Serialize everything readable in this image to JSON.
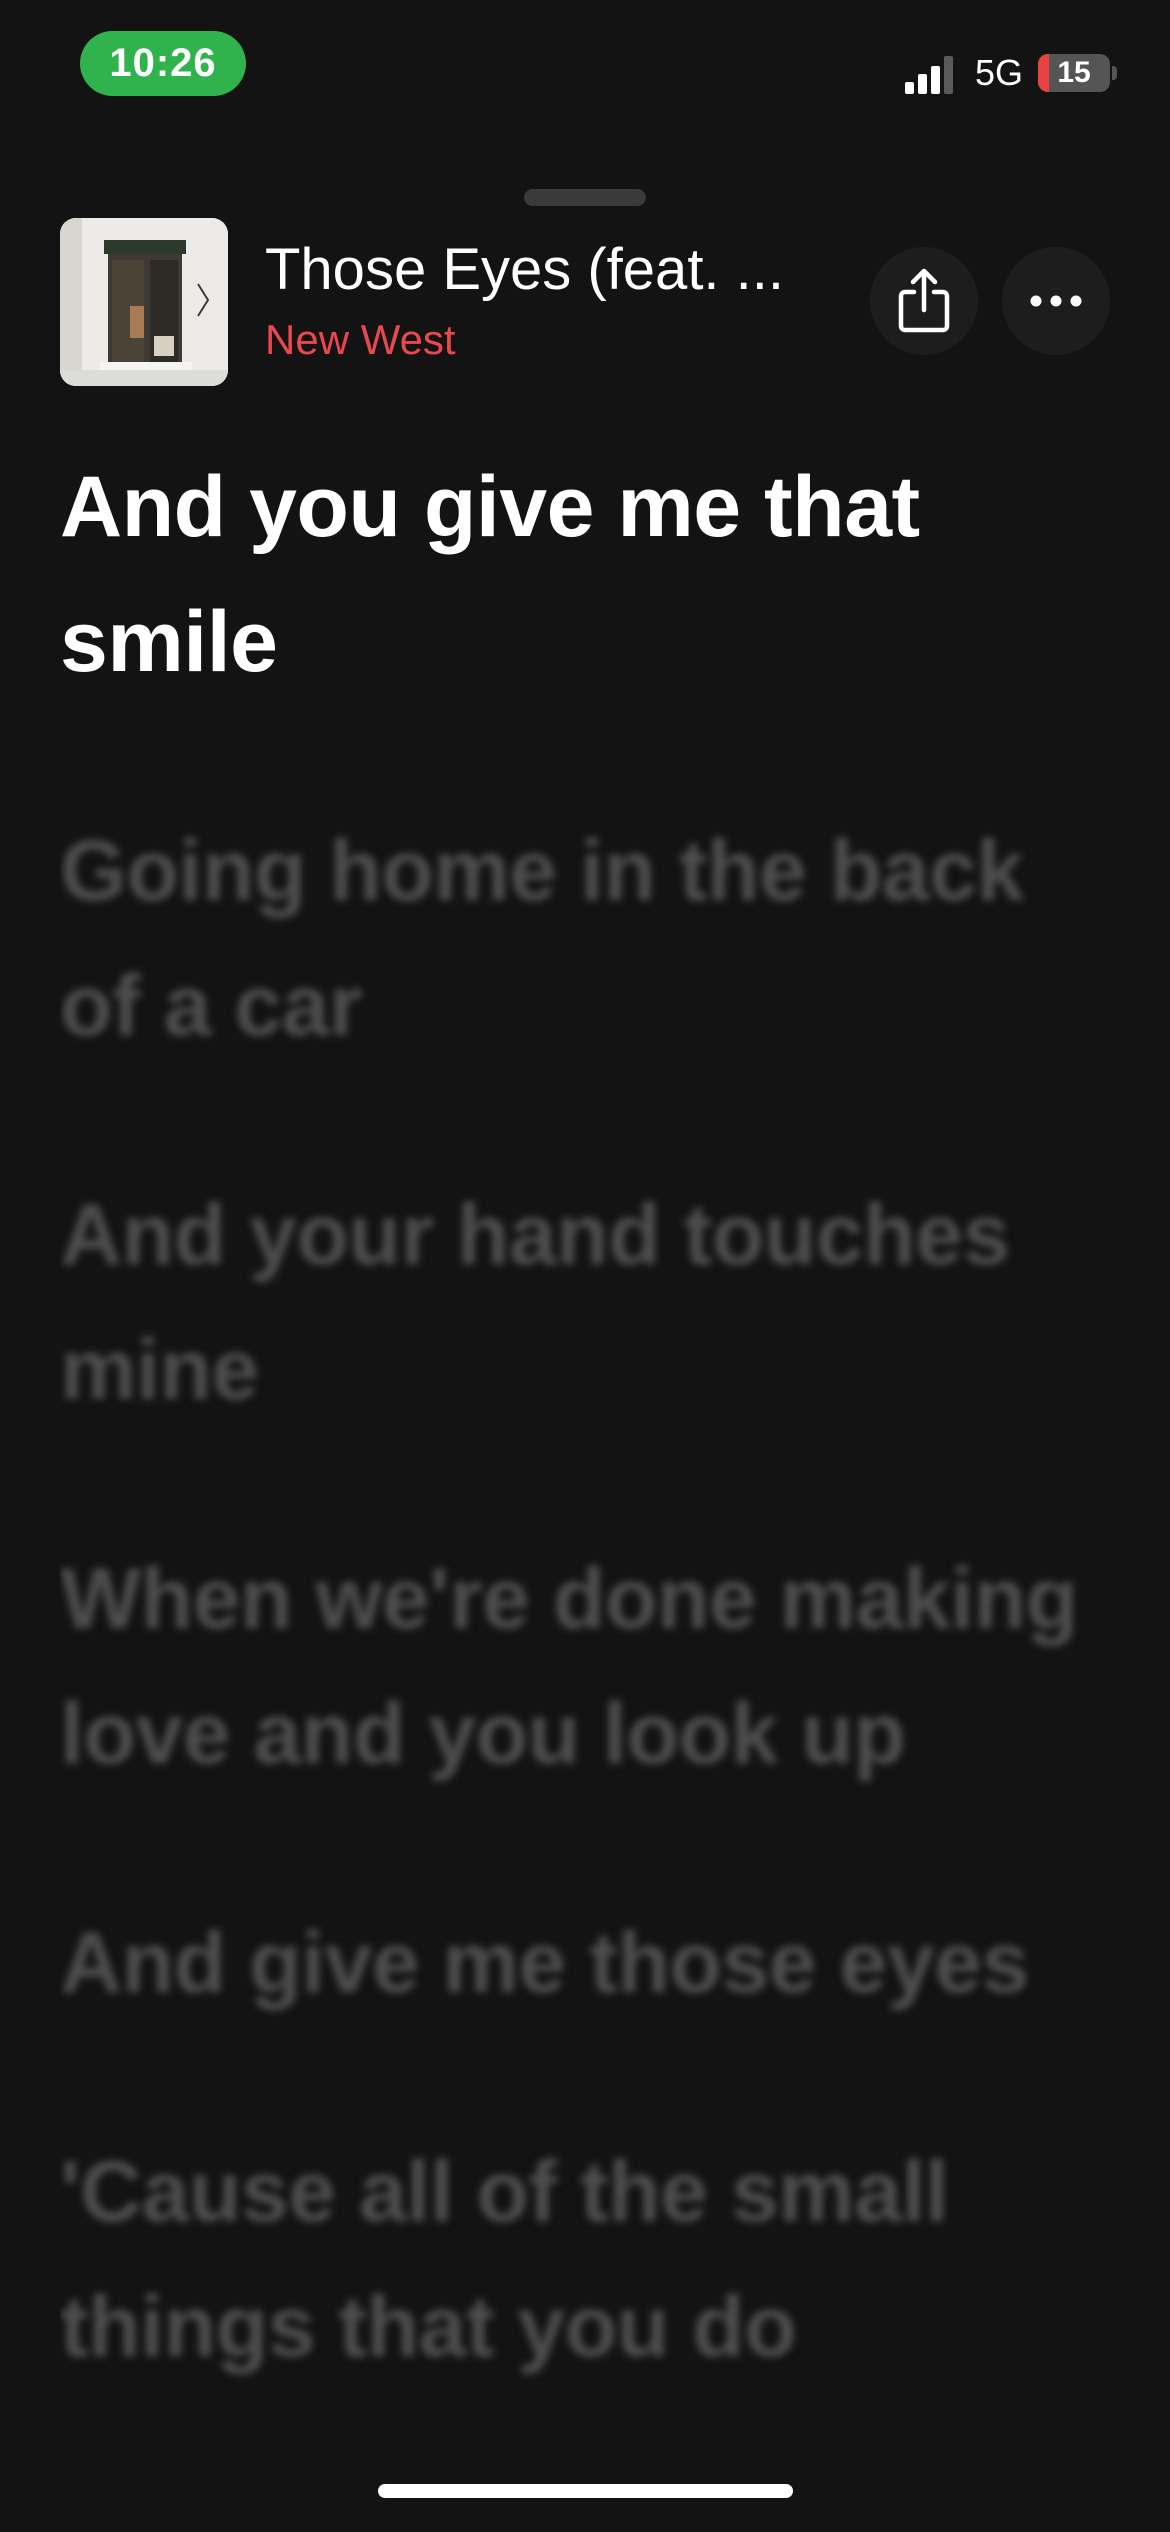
{
  "status_bar": {
    "time": "10:26",
    "network": "5G",
    "battery_level": "15",
    "battery_fraction": 0.15,
    "time_pill_color": "#30b34c",
    "battery_low_color": "#eb4141"
  },
  "now_playing": {
    "title": "Those Eyes (feat. ...",
    "artist": "New West",
    "artist_color": "#e8484e",
    "artwork_icon": "album-artwork-image",
    "share_icon": "share-icon",
    "more_icon": "ellipsis-icon"
  },
  "lyrics": {
    "current": "And you give me that smile",
    "upcoming": [
      "Going home in the back of a car",
      "And your hand touches mine",
      "When we're done making love and you look up",
      "And give me those eyes",
      "'Cause all of the small things that you do"
    ]
  }
}
